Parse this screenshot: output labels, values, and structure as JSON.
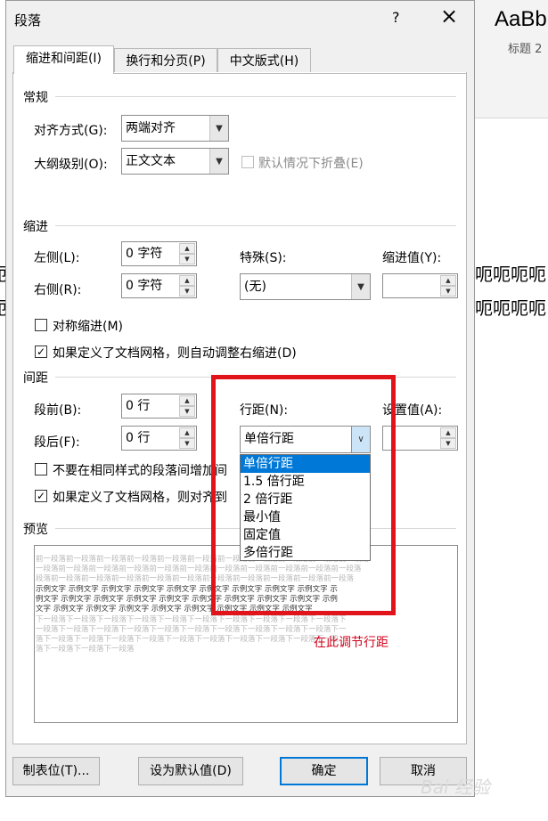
{
  "background": {
    "style_preview": "AaBb",
    "style_name": "标题 2",
    "doc_line1": "呃呃呃呃",
    "doc_line2": "呃呃呃呃",
    "left_edge1": "呃",
    "left_edge2": "呃"
  },
  "dialog": {
    "title": "段落",
    "help": "?",
    "close": "×",
    "tabs": [
      "缩进和间距(I)",
      "换行和分页(P)",
      "中文版式(H)"
    ],
    "general": {
      "heading": "常规",
      "alignment_label": "对齐方式(G):",
      "alignment_value": "两端对齐",
      "outline_label": "大纲级别(O):",
      "outline_value": "正文文本",
      "collapse_label": "默认情况下折叠(E)"
    },
    "indent": {
      "heading": "缩进",
      "left_label": "左侧(L):",
      "left_value": "0 字符",
      "right_label": "右侧(R):",
      "right_value": "0 字符",
      "special_label": "特殊(S):",
      "special_value": "(无)",
      "by_label": "缩进值(Y):",
      "by_value": "",
      "mirror_label": "对称缩进(M)",
      "autoadjust_label": "如果定义了文档网格，则自动调整右缩进(D)"
    },
    "spacing": {
      "heading": "间距",
      "before_label": "段前(B):",
      "before_value": "0 行",
      "after_label": "段后(F):",
      "after_value": "0 行",
      "line_label": "行距(N):",
      "line_value": "单倍行距",
      "at_label": "设置值(A):",
      "at_value": "",
      "nospace_label": "不要在相同样式的段落间增加间",
      "snap_label": "如果定义了文档网格，则对齐到",
      "line_options": [
        "单倍行距",
        "1.5 倍行距",
        "2 倍行距",
        "最小值",
        "固定值",
        "多倍行距"
      ],
      "selected_option": "单倍行距"
    },
    "preview": {
      "heading": "预览",
      "prev_line1": "前一段落前一段落前一段落前一段落前一段落前一段落前一段落前一段落前一段落前一段落前一段落",
      "prev_line2": "一段落前一段落前一段落前一段落前一段落前一段落前一段落前一段落前一段落前一段落前一段落",
      "prev_line3": "段落前一段落前一段落前一段落前一段落前一段落前一段落前一段落前一段落前一段落前一段落",
      "sample_line1": "示例文字 示例文字 示例文字 示例文字 示例文字 示例文字 示例文字 示例文字 示例文字 示",
      "sample_line2": "例文字 示例文字 示例文字 示例文字 示例文字 示例文字 示例文字 示例文字 示例文字 示例",
      "sample_line3": "文字 示例文字 示例文字 示例文字 示例文字 示例文字 示例文字 示例文字 示例文字",
      "next_line1": "下一段落下一段落下一段落下一段落下一段落下一段落下一段落下一段落下一段落下一段落下",
      "next_line2": "一段落下一段落下一段落下一段落下一段落下一段落下一段落下一段落下一段落下一段落下一",
      "next_line3": "落下一段落下一段落下一段落下一段落下一段落下一段落下一段落下一段落下一段落下一段",
      "next_line4": "落下一段落下一段落下一段落"
    },
    "buttons": {
      "tabs": "制表位(T)...",
      "set_default": "设为默认值(D)",
      "ok": "确定",
      "cancel": "取消"
    }
  },
  "annotation": {
    "text": "在此调节行距",
    "color": "#e0141a"
  },
  "watermark": "Bai 经验"
}
